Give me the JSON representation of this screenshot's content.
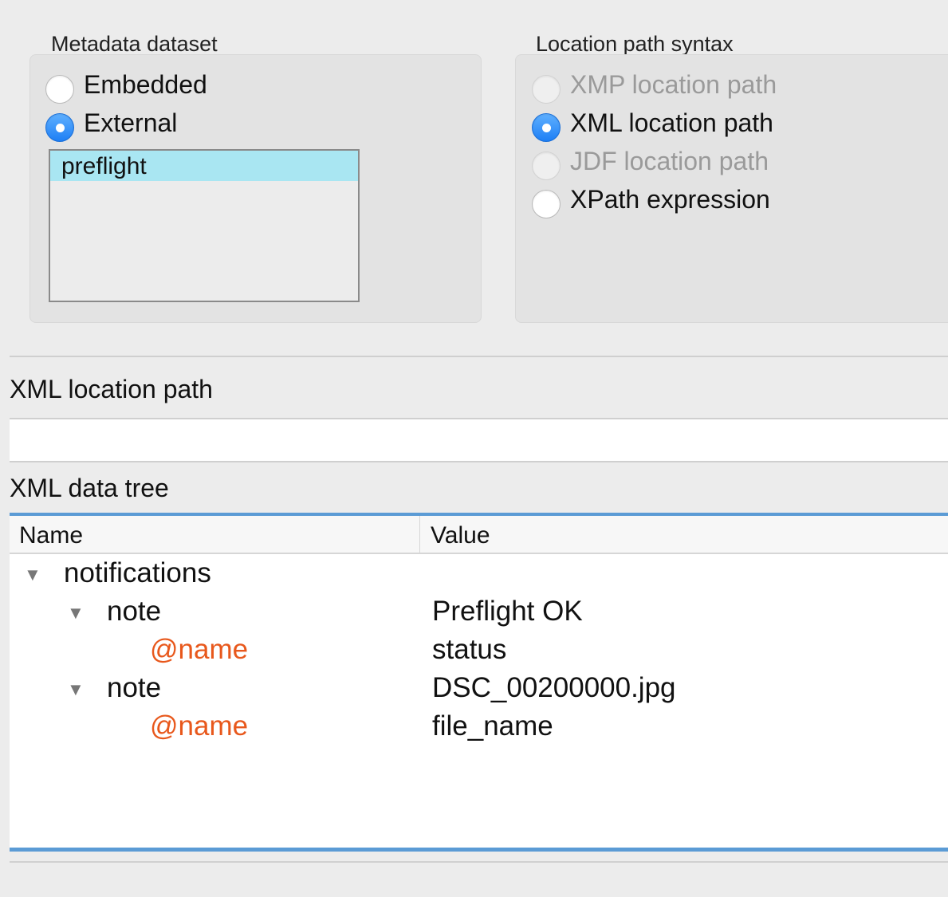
{
  "metadata_dataset": {
    "title": "Metadata dataset",
    "options": [
      {
        "label": "Embedded",
        "checked": false,
        "disabled": false
      },
      {
        "label": "External",
        "checked": true,
        "disabled": false
      }
    ],
    "datasets": [
      "preflight"
    ]
  },
  "location_path_syntax": {
    "title": "Location path syntax",
    "options": [
      {
        "label": "XMP location path",
        "checked": false,
        "disabled": true
      },
      {
        "label": "XML location path",
        "checked": true,
        "disabled": false
      },
      {
        "label": "JDF location path",
        "checked": false,
        "disabled": true
      },
      {
        "label": "XPath expression",
        "checked": false,
        "disabled": false
      }
    ]
  },
  "xml_location_path": {
    "label": "XML location path"
  },
  "xml_data_tree": {
    "label": "XML data tree",
    "columns": {
      "name": "Name",
      "value": "Value"
    },
    "rows": [
      {
        "name": "notifications",
        "value": "",
        "attribute": false,
        "expanded": true
      },
      {
        "name": "note",
        "value": "Preflight OK",
        "attribute": false,
        "expanded": true
      },
      {
        "name": "@name",
        "value": "status",
        "attribute": true,
        "expanded": false
      },
      {
        "name": "note",
        "value": "DSC_00200000.jpg",
        "attribute": false,
        "expanded": true
      },
      {
        "name": "@name",
        "value": "file_name",
        "attribute": true,
        "expanded": false
      }
    ]
  },
  "colors": {
    "accent": "#1e7ff5",
    "selection": "#a9e6f2",
    "attribute": "#e8581c",
    "divider": "#5b9bd5"
  },
  "icons": {
    "expand": "triangle-down-icon"
  }
}
